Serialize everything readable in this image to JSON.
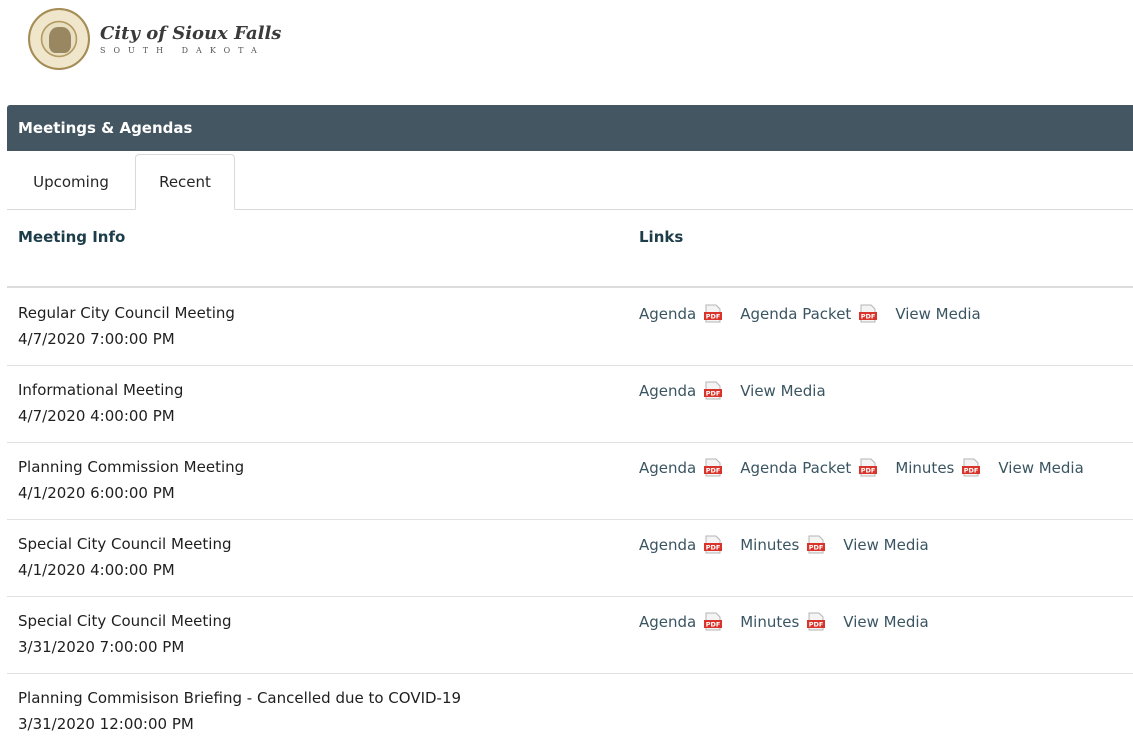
{
  "logo": {
    "title": "City of Sioux Falls",
    "subtitle": "SOUTH DAKOTA"
  },
  "header": {
    "title": "Meetings & Agendas",
    "color": "#435662"
  },
  "tabs": [
    {
      "label": "Upcoming",
      "active": false
    },
    {
      "label": "Recent",
      "active": true
    }
  ],
  "columns": {
    "info": "Meeting Info",
    "links": "Links"
  },
  "meetings": [
    {
      "name": "Regular City Council Meeting",
      "date": "4/7/2020 7:00:00 PM",
      "links": [
        {
          "label": "Agenda",
          "pdf": true
        },
        {
          "label": "Agenda Packet",
          "pdf": true
        },
        {
          "label": "View Media",
          "pdf": false
        }
      ]
    },
    {
      "name": "Informational Meeting",
      "date": "4/7/2020 4:00:00 PM",
      "links": [
        {
          "label": "Agenda",
          "pdf": true
        },
        {
          "label": "View Media",
          "pdf": false
        }
      ]
    },
    {
      "name": "Planning Commission Meeting",
      "date": "4/1/2020 6:00:00 PM",
      "links": [
        {
          "label": "Agenda",
          "pdf": true
        },
        {
          "label": "Agenda Packet",
          "pdf": true
        },
        {
          "label": "Minutes",
          "pdf": true
        },
        {
          "label": "View Media",
          "pdf": false
        }
      ]
    },
    {
      "name": "Special City Council Meeting",
      "date": "4/1/2020 4:00:00 PM",
      "links": [
        {
          "label": "Agenda",
          "pdf": true
        },
        {
          "label": "Minutes",
          "pdf": true
        },
        {
          "label": "View Media",
          "pdf": false
        }
      ]
    },
    {
      "name": "Special City Council Meeting",
      "date": "3/31/2020 7:00:00 PM",
      "links": [
        {
          "label": "Agenda",
          "pdf": true
        },
        {
          "label": "Minutes",
          "pdf": true
        },
        {
          "label": "View Media",
          "pdf": false
        }
      ]
    },
    {
      "name": "Planning Commisison Briefing - Cancelled due to COVID-19",
      "date": "3/31/2020 12:00:00 PM",
      "links": []
    }
  ]
}
